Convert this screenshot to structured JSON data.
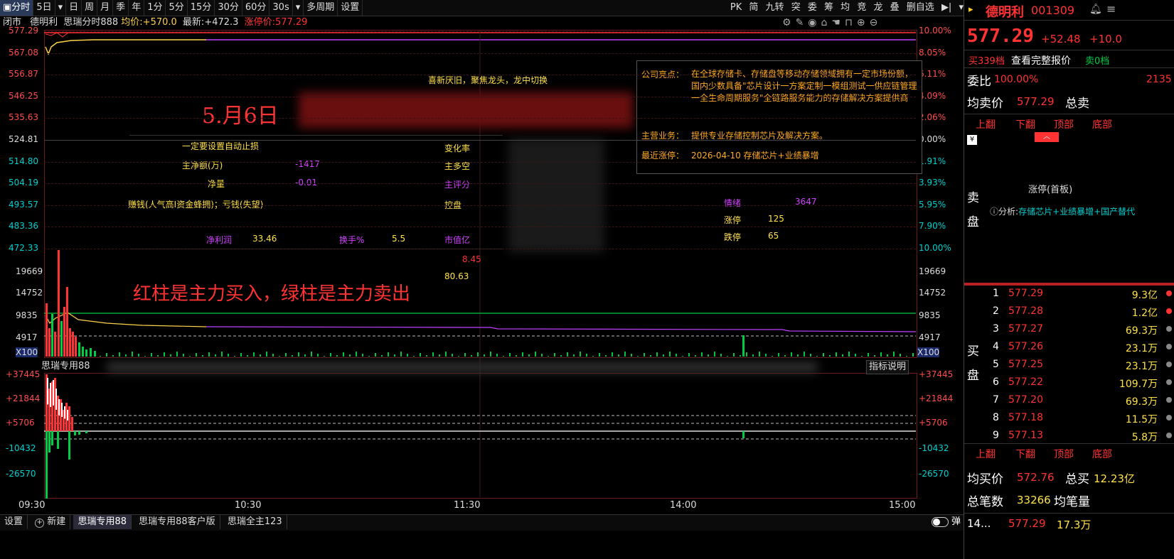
{
  "toolbar": {
    "left_items": [
      "分时",
      "5日",
      "日",
      "周",
      "月",
      "季",
      "年",
      "1分",
      "5分",
      "15分",
      "30分",
      "60分",
      "30s",
      "多周期",
      "设置"
    ],
    "right_items": [
      "PK",
      "简",
      "九转",
      "突",
      "委",
      "筹",
      "均",
      "竞",
      "龙",
      "叠",
      "删自选"
    ]
  },
  "chart_header": {
    "status": "闭市",
    "stock_name": "德明利",
    "indicator": "思瑞分时888",
    "avg_label": "均价:",
    "avg_value": "+570.0",
    "latest_label": "最新:",
    "latest_value": "+472.3",
    "limit_label": "涨停价:",
    "limit_value": "577.29"
  },
  "price_axis": {
    "left": [
      "577.29",
      "567.08",
      "556.87",
      "546.25",
      "535.63",
      "524.81",
      "514.80",
      "504.19",
      "493.57",
      "483.36",
      "472.33"
    ],
    "right": [
      "10.00%",
      "8.05%",
      "6.11%",
      "4.09%",
      "2.06%",
      "0.00%",
      "1.91%",
      "3.93%",
      "5.95%",
      "7.90%",
      "10.00%"
    ]
  },
  "volume_axis": {
    "labels": [
      "19669",
      "14752",
      "9835",
      "4917",
      "X100"
    ]
  },
  "indicator_panel": {
    "title": "思瑞专用88",
    "explain_button": "指标说明",
    "axis_left": [
      "+37445",
      "+21844",
      "+5706",
      "-10432",
      "-26570"
    ],
    "axis_right": [
      "+37445",
      "+21844",
      "+5706",
      "-10432",
      "-26570"
    ]
  },
  "time_axis": [
    "09:30",
    "10:30",
    "11:30",
    "14:00",
    "15:00"
  ],
  "annotations": {
    "date_note": "5.月6日",
    "bar_note": "红柱是主力买入，绿柱是主力卖出",
    "slogan": "喜新厌旧，聚焦龙头，龙中切换"
  },
  "overlay": {
    "stop_loss": "一定要设置自动止损",
    "net_main_label": "主净额(万)",
    "net_main_value": "-1417",
    "net_label": "净量",
    "net_value": "-0.01",
    "money_rule": "赚钱(人气高I资金蜂拥)；亏钱(失望)",
    "change_rate_label": "变化率",
    "main_long_short": "主多空",
    "main_score": "主评分",
    "control": "控盘",
    "profit_label": "净利润",
    "profit_value": "33.46",
    "turnover_label": "换手%",
    "turnover_value": "5.5",
    "mktcap_label": "市值亿",
    "val1": "8.45",
    "val2": "80.63",
    "mood_label": "情绪",
    "mood_value": "3647",
    "limit_up_label": "涨停",
    "limit_up_value": "125",
    "limit_down_label": "跌停",
    "limit_down_value": "65"
  },
  "company_info": {
    "highlight_label": "公司亮点：",
    "highlight_text": "在全球存储卡、存储盘等移动存储领域拥有一定市场份额，国内少数具备\"芯片设计一方案定制一模组测试一供应链管理一全生命周期服务\"全链路服务能力的存储解决方案提供商",
    "business_label": "主营业务：",
    "business_text": "提供专业存储控制芯片及解决方案。",
    "recent_label": "最近涨停：",
    "recent_text": "2026-04-10 存储芯片+业绩暴增"
  },
  "bottom_bar": {
    "settings": "设置",
    "new": "新建",
    "tabs": [
      "思瑞专用88",
      "思瑞专用88客户版",
      "思瑞全主123"
    ],
    "toggle": "弹"
  },
  "quote": {
    "name": "德明利",
    "code": "001309",
    "price": "577.29",
    "change": "+52.48",
    "change_pct": "+10.0",
    "buy_tab": "买339档",
    "view_full": "查看完整报价",
    "sell_tab": "卖0档",
    "ratio_label": "委比",
    "ratio_value": "100.00%",
    "ratio_diff": "2135",
    "avg_sell_label": "均卖价",
    "avg_sell_value": "577.29",
    "total_sell_label": "总卖",
    "page_buttons": [
      "上翻",
      "下翻",
      "顶部",
      "底部"
    ],
    "sell_side_label": "卖盘",
    "limit_status": "涨停(首板)",
    "analysis_label": "分析:",
    "analysis_text": "存储芯片+业绩暴增+国产替代",
    "buy_side_label": "买盘",
    "bids": [
      {
        "level": "1",
        "price": "577.29",
        "vol": "9.3亿"
      },
      {
        "level": "2",
        "price": "577.28",
        "vol": "1.2亿"
      },
      {
        "level": "3",
        "price": "577.27",
        "vol": "69.3万"
      },
      {
        "level": "4",
        "price": "577.26",
        "vol": "23.1万"
      },
      {
        "level": "5",
        "price": "577.25",
        "vol": "23.1万"
      },
      {
        "level": "6",
        "price": "577.22",
        "vol": "109.7万"
      },
      {
        "level": "7",
        "price": "577.20",
        "vol": "69.3万"
      },
      {
        "level": "8",
        "price": "577.18",
        "vol": "11.5万"
      },
      {
        "level": "9",
        "price": "577.13",
        "vol": "5.8万"
      }
    ],
    "avg_buy_label": "均买价",
    "avg_buy_value": "572.76",
    "total_buy_label": "总买",
    "total_buy_value": "12.23亿",
    "total_trades_label": "总笔数",
    "total_trades_value": "33266",
    "avg_trade_label": "均笔量",
    "last_tick_time": "14...",
    "last_tick_price": "577.29",
    "last_tick_vol": "17.3万"
  },
  "colors": {
    "up": "#ff3333",
    "down": "#00cc44",
    "avg_line": "#ffd24a",
    "price_line": "#c040ff",
    "accent": "#ff3333"
  }
}
